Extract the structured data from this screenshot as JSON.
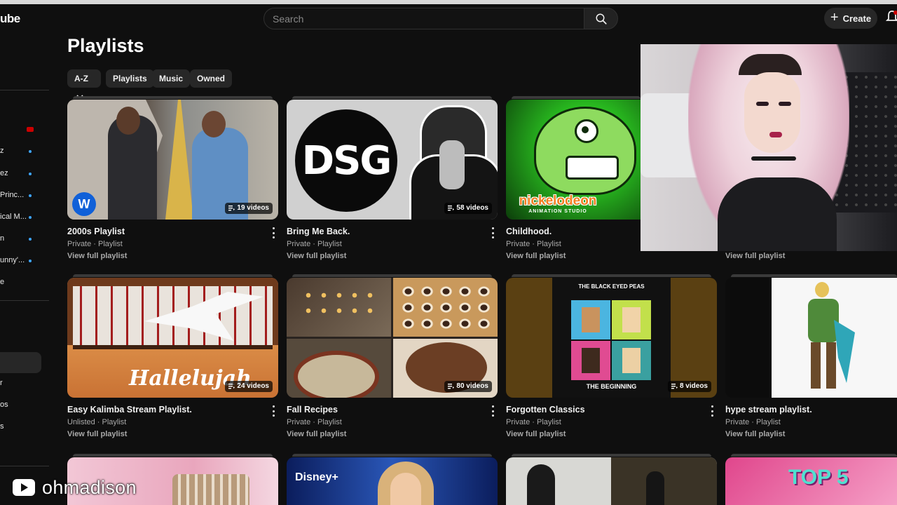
{
  "app": {
    "logo_text": "ube"
  },
  "search": {
    "placeholder": "Search"
  },
  "header": {
    "create_label": "Create"
  },
  "sidebar": {
    "items": [
      {
        "label": "",
        "dot": false
      },
      {
        "label": "z",
        "dot": true
      },
      {
        "label": "ez",
        "dot": true
      },
      {
        "label": "Princ...",
        "dot": true
      },
      {
        "label": "ical M...",
        "dot": true
      },
      {
        "label": "n",
        "dot": true
      },
      {
        "label": "unny'...",
        "dot": true
      },
      {
        "label": "e",
        "dot": false
      },
      {
        "label": "r",
        "dot": false
      },
      {
        "label": "os",
        "dot": false
      },
      {
        "label": "s",
        "dot": false
      }
    ]
  },
  "page": {
    "title": "Playlists",
    "chips": [
      {
        "label": "A-Z"
      },
      {
        "label": "Playlists"
      },
      {
        "label": "Music"
      },
      {
        "label": "Owned"
      }
    ]
  },
  "playlists": [
    {
      "title": "2000s Playlist",
      "meta": "Private · Playlist",
      "link": "View full playlist",
      "count": "19 videos"
    },
    {
      "title": "Bring Me Back.",
      "meta": "Private · Playlist",
      "link": "View full playlist",
      "count": "58 videos"
    },
    {
      "title": "Childhood.",
      "meta": "Private · Playlist",
      "link": "View full playlist",
      "count": ""
    },
    {
      "title": "",
      "meta": "",
      "link": "View full playlist",
      "count": ""
    },
    {
      "title": "Easy Kalimba Stream Playlist.",
      "meta": "Unlisted · Playlist",
      "link": "View full playlist",
      "count": "24 videos"
    },
    {
      "title": "Fall Recipes",
      "meta": "Private · Playlist",
      "link": "View full playlist",
      "count": "80 videos"
    },
    {
      "title": "Forgotten Classics",
      "meta": "Private · Playlist",
      "link": "View full playlist",
      "count": "8 videos"
    },
    {
      "title": "hype stream playlist.",
      "meta": "Private · Playlist",
      "link": "View full playlist",
      "count": ""
    }
  ],
  "thumb_text": {
    "dsg": "DSG",
    "nick": "nickelodeon",
    "nick_sub": "ANIMATION STUDIO",
    "hallelujah": "Hallelujah",
    "bep": "THE BLACK EYED PEAS",
    "bep_sub": "THE BEGINNING",
    "disney": "Disney+",
    "top5": "TOP 5"
  },
  "watermark": {
    "handle": "ohmadison"
  }
}
